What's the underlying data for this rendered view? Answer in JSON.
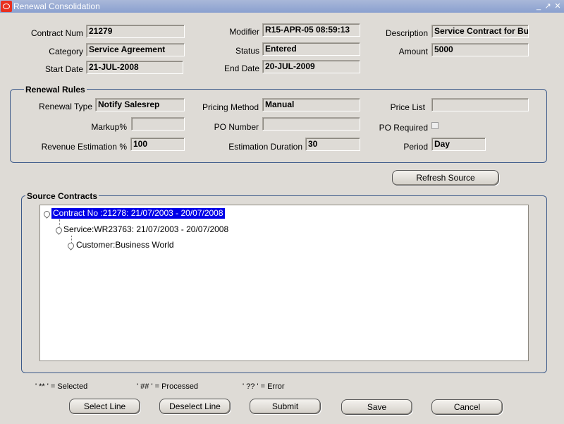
{
  "window": {
    "title": "Renewal Consolidation",
    "controls": [
      "minimize-icon",
      "restore-icon",
      "close-icon"
    ]
  },
  "header": {
    "contract_num_label": "Contract Num",
    "contract_num": "21279",
    "modifier_label": "Modifier",
    "modifier": "R15-APR-05 08:59:13",
    "description_label": "Description",
    "description": "Service Contract for Bu",
    "category_label": "Category",
    "category": "Service Agreement",
    "status_label": "Status",
    "status": "Entered",
    "amount_label": "Amount",
    "amount": "5000",
    "start_date_label": "Start Date",
    "start_date": "21-JUL-2008",
    "end_date_label": "End Date",
    "end_date": "20-JUL-2009"
  },
  "renewal_rules": {
    "title": "Renewal Rules",
    "renewal_type_label": "Renewal Type",
    "renewal_type": "Notify Salesrep",
    "pricing_method_label": "Pricing Method",
    "pricing_method": "Manual",
    "price_list_label": "Price List",
    "price_list": "",
    "markup_label": "Markup%",
    "markup": "",
    "po_number_label": "PO Number",
    "po_number": "",
    "po_required_label": "PO Required",
    "po_required": false,
    "revenue_estimation_label": "Revenue Estimation %",
    "revenue_estimation": "100",
    "estimation_duration_label": "Estimation Duration",
    "estimation_duration": "30",
    "period_label": "Period",
    "period": "Day"
  },
  "refresh_source_label": "Refresh Source",
  "source_contracts": {
    "title": "Source Contracts",
    "nodes": [
      {
        "label": "Contract No :21278: 21/07/2003 - 20/07/2008",
        "level": 0,
        "selected": true
      },
      {
        "label": "Service:WR23763: 21/07/2003 - 20/07/2008",
        "level": 1,
        "selected": false
      },
      {
        "label": "Customer:Business World",
        "level": 2,
        "selected": false
      }
    ]
  },
  "legend": {
    "selected": "' ** ' = Selected",
    "processed": "' ## ' = Processed",
    "error": "' ?? ' = Error"
  },
  "buttons": {
    "select_line": "Select Line",
    "deselect_line": "Deselect Line",
    "submit": "Submit",
    "save": "Save",
    "cancel": "Cancel"
  }
}
